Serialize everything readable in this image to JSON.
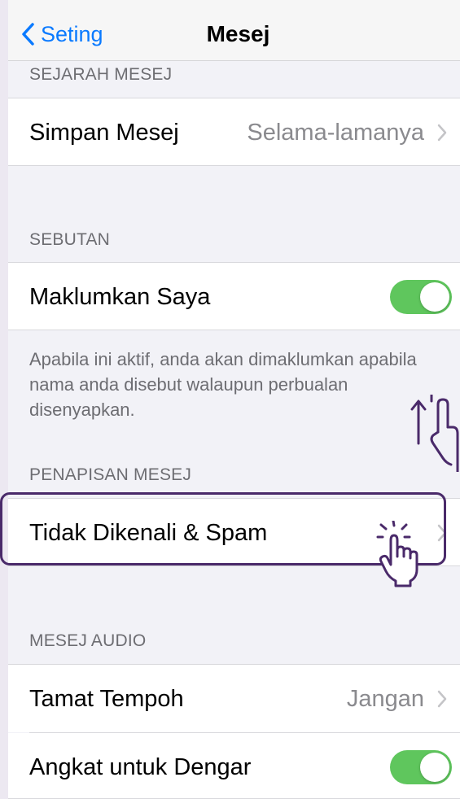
{
  "navbar": {
    "back_label": "Seting",
    "title": "Mesej"
  },
  "sections": {
    "history": {
      "header": "SEJARAH MESEJ",
      "keep_label": "Simpan Mesej",
      "keep_value": "Selama-lamanya"
    },
    "mentions": {
      "header": "SEBUTAN",
      "notify_label": "Maklumkan Saya",
      "notify_on": true,
      "note": "Apabila ini aktif, anda akan dimaklumkan apabila nama anda disebut walaupun perbualan disenyapkan."
    },
    "filtering": {
      "header": "PENAPISAN MESEJ",
      "unknown_label": "Tidak Dikenali & Spam"
    },
    "audio": {
      "header": "MESEJ AUDIO",
      "expire_label": "Tamat Tempoh",
      "expire_value": "Jangan",
      "raise_label": "Angkat untuk Dengar",
      "raise_on": true
    }
  },
  "colors": {
    "accent": "#0a7aff",
    "toggle_on": "#5fc65d",
    "highlight": "#4a2a6a"
  }
}
